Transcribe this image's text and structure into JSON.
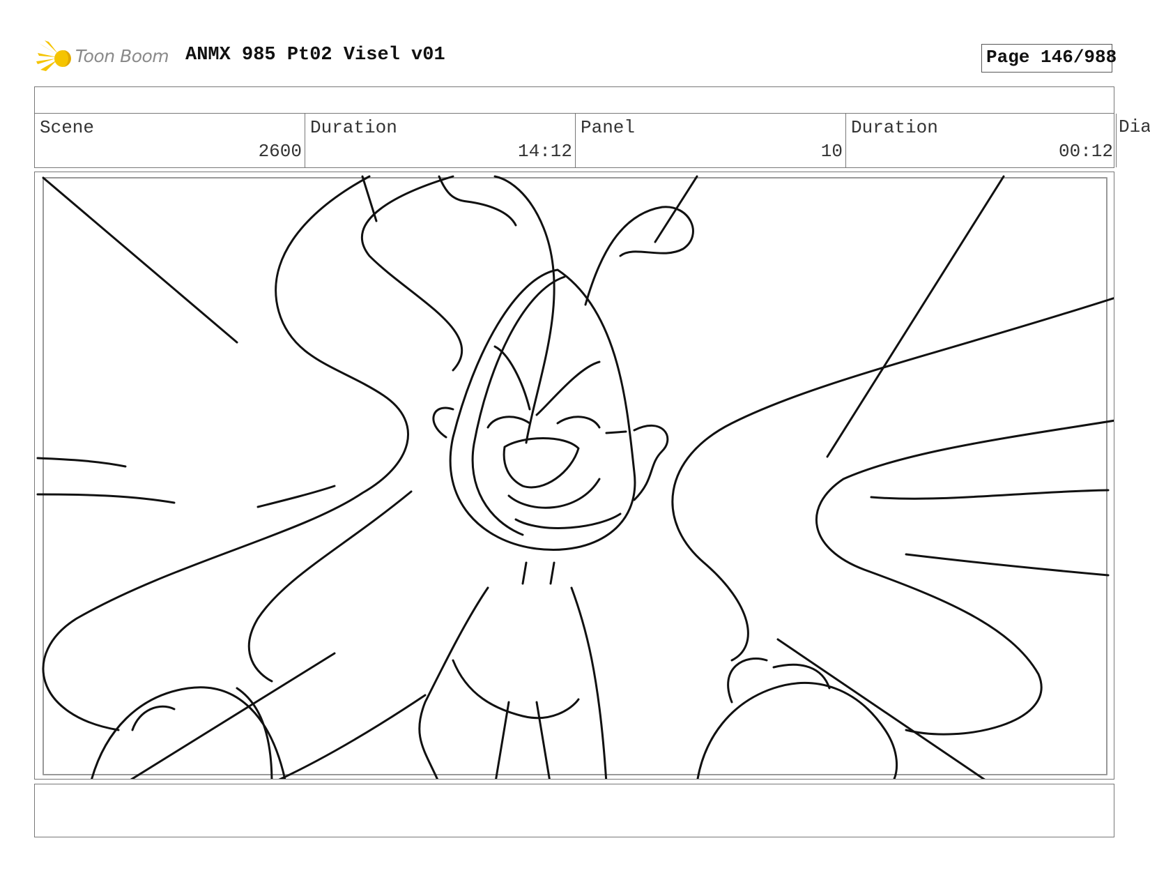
{
  "header": {
    "logo_text": "Toon Boom",
    "logo_icon": "toon-boom-starburst-icon",
    "title": "ANMX 985 Pt02 Visel v01",
    "page_label": "Page 146/988"
  },
  "info": {
    "scene_label": "Scene",
    "scene_value": "2600",
    "scene_duration_label": "Duration",
    "scene_duration_value": "14:12",
    "panel_label": "Panel",
    "panel_value": "10",
    "panel_duration_label": "Duration",
    "panel_duration_value": "00:12",
    "dialog_label": "Dia"
  },
  "colors": {
    "logo_accent": "#f5c400",
    "border": "#777777",
    "sketch_line": "#111111"
  }
}
